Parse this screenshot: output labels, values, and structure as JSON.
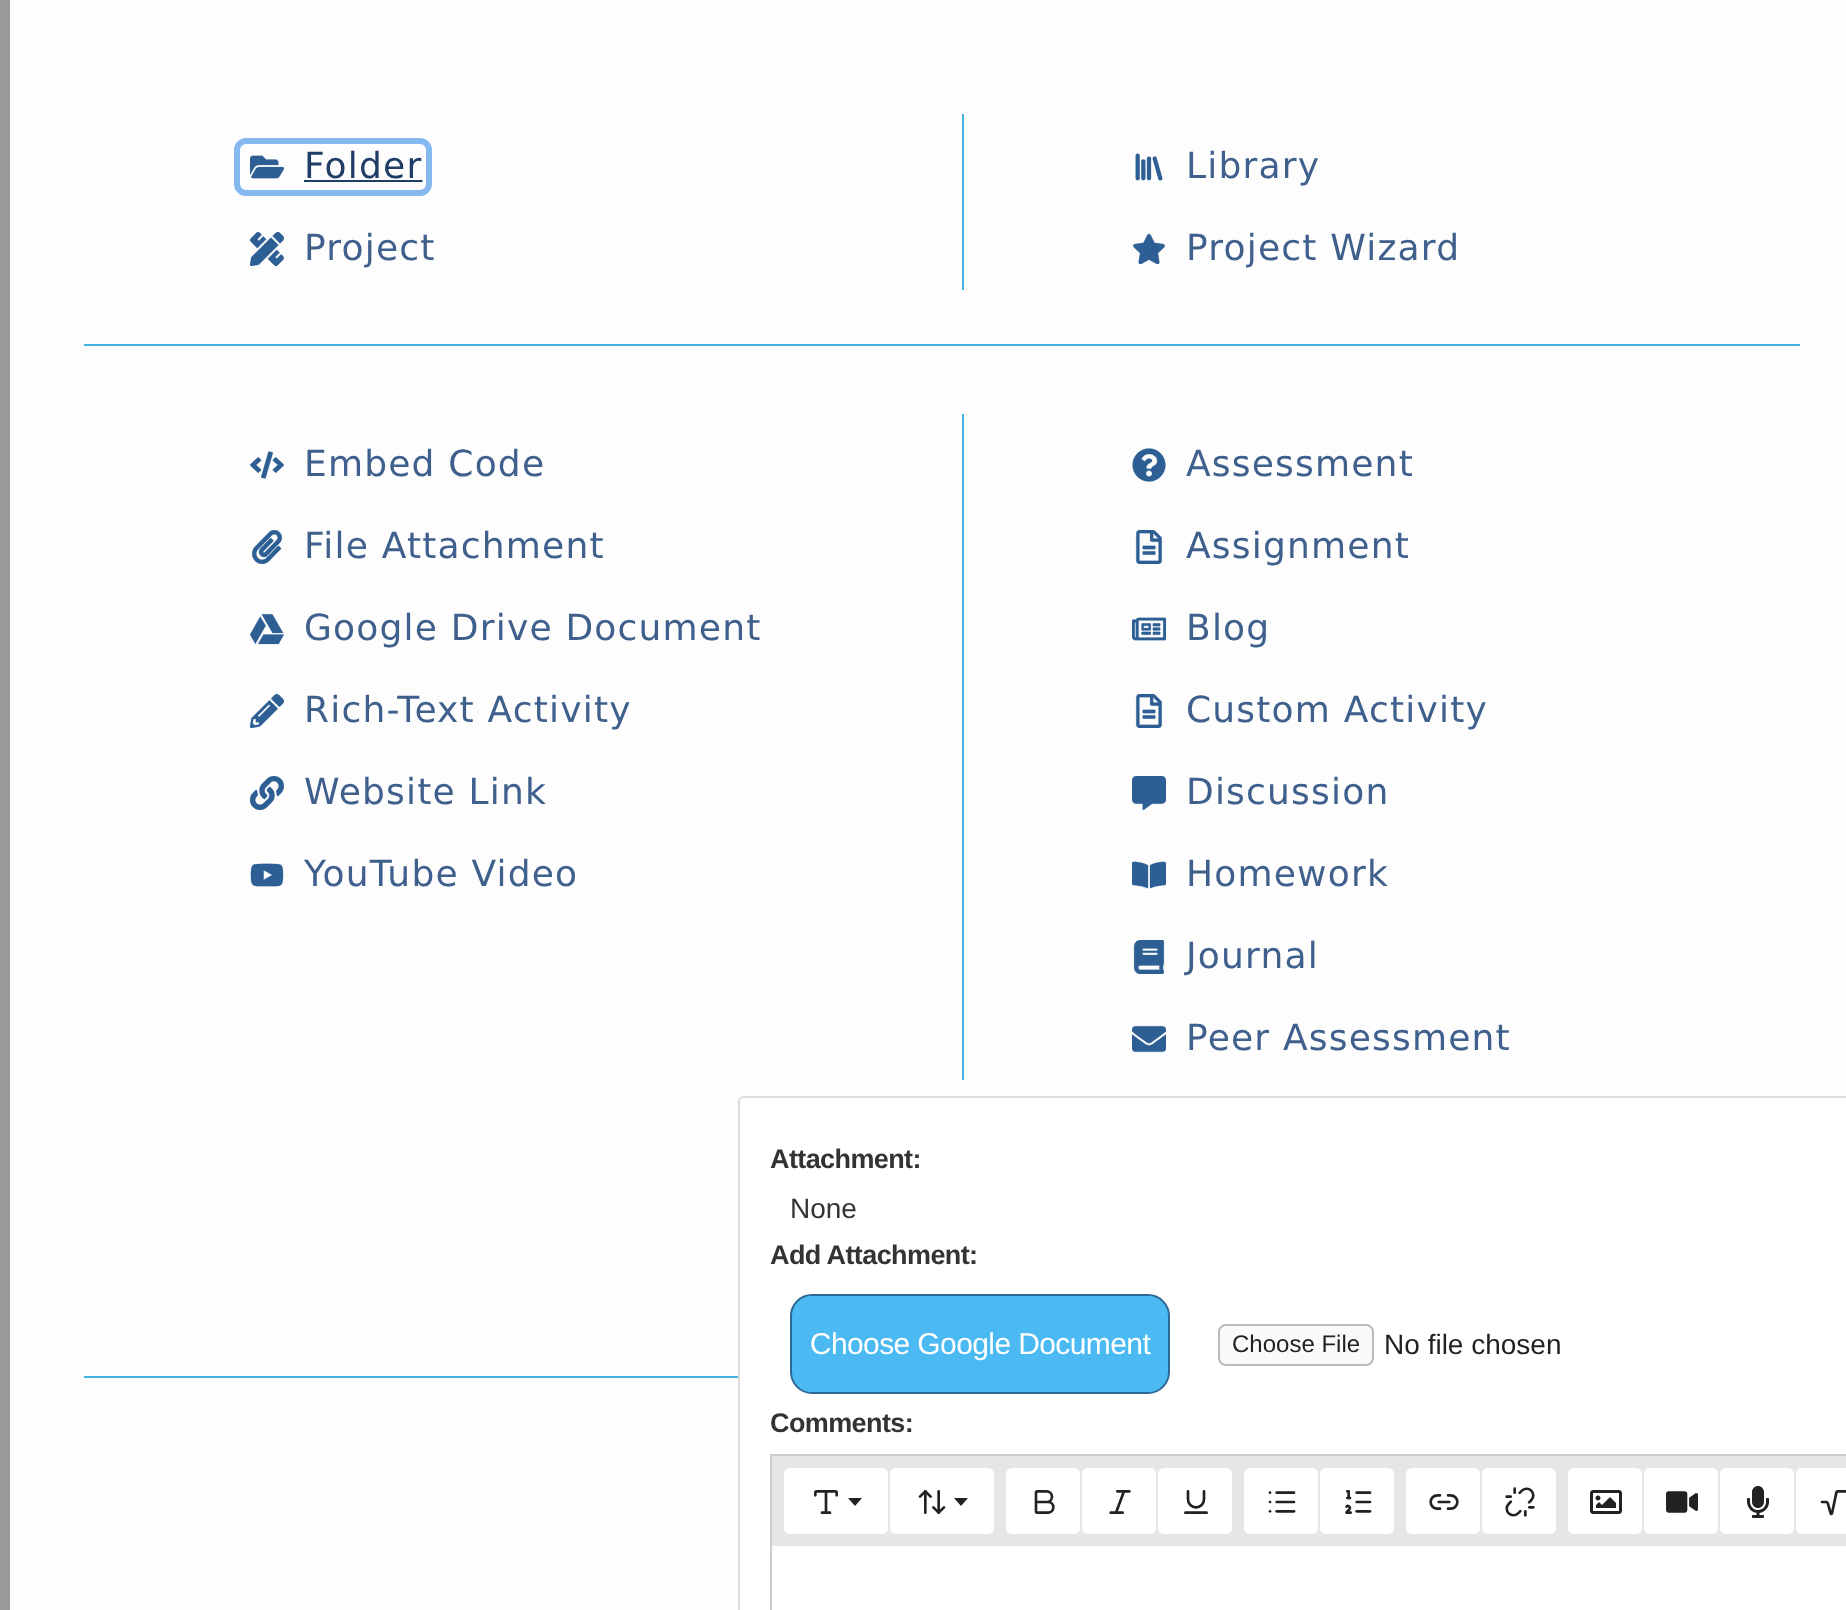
{
  "top_menu": {
    "left": [
      {
        "label": "Folder",
        "focused": true
      },
      {
        "label": "Project",
        "focused": false
      }
    ],
    "right": [
      {
        "label": "Library",
        "focused": false
      },
      {
        "label": "Project Wizard",
        "focused": false
      }
    ]
  },
  "activity_menu": {
    "left": [
      {
        "label": "Embed Code",
        "focused": false
      },
      {
        "label": "File Attachment",
        "focused": false
      },
      {
        "label": "Google Drive Document",
        "focused": false
      },
      {
        "label": "Rich-Text Activity",
        "focused": false
      },
      {
        "label": "Website Link",
        "focused": false
      },
      {
        "label": "YouTube Video",
        "focused": false
      }
    ],
    "right": [
      {
        "label": "Assessment",
        "focused": false
      },
      {
        "label": "Assignment",
        "focused": false
      },
      {
        "label": "Blog",
        "focused": false
      },
      {
        "label": "Custom Activity",
        "focused": false
      },
      {
        "label": "Discussion",
        "focused": false
      },
      {
        "label": "Homework",
        "focused": false
      },
      {
        "label": "Journal",
        "focused": false
      },
      {
        "label": "Peer Assessment",
        "focused": false
      }
    ]
  },
  "attachment_panel": {
    "attachment_label": "Attachment:",
    "attachment_value": "None",
    "add_label": "Add Attachment:",
    "google_button": "Choose Google Document",
    "file_button": "Choose File",
    "file_status": "No file chosen",
    "comments_label": "Comments:"
  }
}
